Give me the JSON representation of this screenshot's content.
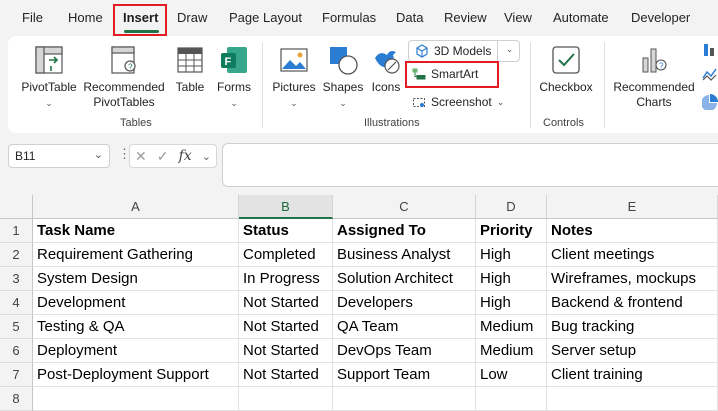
{
  "tabs": [
    "File",
    "Home",
    "Insert",
    "Draw",
    "Page Layout",
    "Formulas",
    "Data",
    "Review",
    "View",
    "Automate",
    "Developer"
  ],
  "active_tab": "Insert",
  "ribbon": {
    "tables_group": {
      "label": "Tables",
      "pivottable": "PivotTable",
      "pivottable_dropdown": "⌄",
      "recommended_pivot_line1": "Recommended",
      "recommended_pivot_line2": "PivotTables",
      "table": "Table",
      "forms": "Forms",
      "forms_dropdown": "⌄"
    },
    "illustrations_group": {
      "label": "Illustrations",
      "pictures": "Pictures",
      "pictures_dropdown": "⌄",
      "shapes": "Shapes",
      "shapes_dropdown": "⌄",
      "icons": "Icons",
      "models3d": "3D Models",
      "models3d_dropdown": "⌄",
      "smartart": "SmartArt",
      "screenshot": "Screenshot",
      "screenshot_dropdown": "⌄"
    },
    "controls_group": {
      "label": "Controls",
      "checkbox": "Checkbox"
    },
    "charts": {
      "recommended_line1": "Recommended",
      "recommended_line2": "Charts"
    }
  },
  "formula_bar": {
    "name_box": "B11",
    "name_box_chevron": "⌄",
    "more": "⋮",
    "cancel": "✕",
    "enter": "✓",
    "fx": "fx",
    "fx_dropdown": "⌄",
    "value": ""
  },
  "grid": {
    "columns": [
      "A",
      "B",
      "C",
      "D",
      "E"
    ],
    "selected_column": "B",
    "row_numbers": [
      "1",
      "2",
      "3",
      "4",
      "5",
      "6",
      "7",
      "8"
    ],
    "rows": [
      [
        "Task Name",
        "Status",
        "Assigned To",
        "Priority",
        "Notes"
      ],
      [
        "Requirement Gathering",
        "Completed",
        "Business Analyst",
        "High",
        "Client meetings"
      ],
      [
        "System Design",
        "In Progress",
        "Solution Architect",
        "High",
        "Wireframes, mockups"
      ],
      [
        "Development",
        "Not Started",
        "Developers",
        "High",
        "Backend & frontend"
      ],
      [
        "Testing & QA",
        "Not Started",
        "QA Team",
        "Medium",
        "Bug tracking"
      ],
      [
        "Deployment",
        "Not Started",
        "DevOps Team",
        "Medium",
        "Server setup"
      ],
      [
        "Post-Deployment Support",
        "Not Started",
        "Support Team",
        "Low",
        "Client training"
      ],
      [
        "",
        "",
        "",
        "",
        ""
      ]
    ]
  },
  "colors": {
    "accent_green": "#217346",
    "highlight_red": "#e31b23"
  }
}
